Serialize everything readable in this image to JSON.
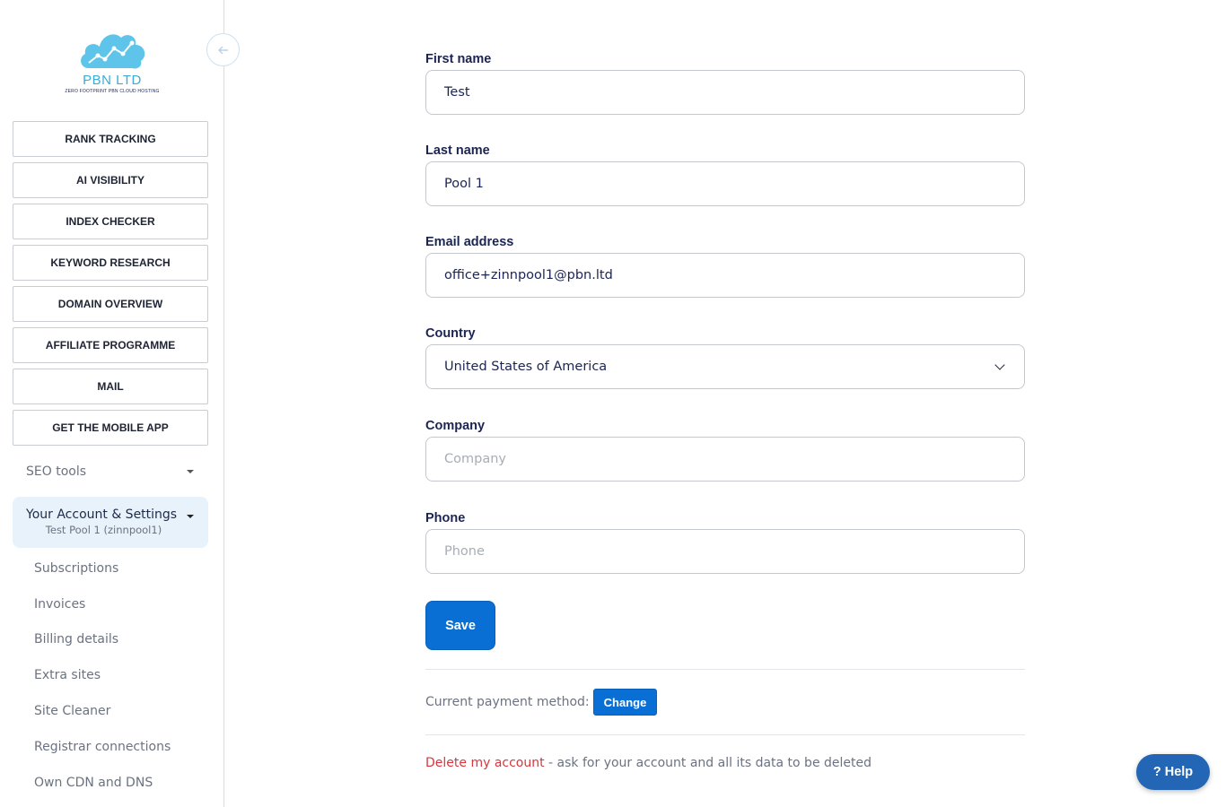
{
  "sidebar": {
    "logo_title": "PBN LTD",
    "logo_subtitle": "ZERO FOOTPRINT PBN CLOUD HOSTING",
    "nav_buttons": [
      {
        "label": "RANK TRACKING"
      },
      {
        "label": "AI VISIBILITY"
      },
      {
        "label": "INDEX CHECKER"
      },
      {
        "label": "KEYWORD RESEARCH"
      },
      {
        "label": "DOMAIN OVERVIEW"
      },
      {
        "label": "AFFILIATE PROGRAMME"
      },
      {
        "label": "MAIL"
      },
      {
        "label": "GET THE MOBILE APP"
      }
    ],
    "seo_tools_label": "SEO tools",
    "account": {
      "title": "Your Account & Settings",
      "subtitle": "Test Pool 1 (zinnpool1)"
    },
    "sub_items": [
      {
        "label": "Subscriptions"
      },
      {
        "label": "Invoices"
      },
      {
        "label": "Billing details"
      },
      {
        "label": "Extra sites"
      },
      {
        "label": "Site Cleaner"
      },
      {
        "label": "Registrar connections"
      },
      {
        "label": "Own CDN and DNS"
      }
    ]
  },
  "form": {
    "first_name": {
      "label": "First name",
      "value": "Test"
    },
    "last_name": {
      "label": "Last name",
      "value": "Pool 1"
    },
    "email": {
      "label": "Email address",
      "value": "office+zinnpool1@pbn.ltd"
    },
    "country": {
      "label": "Country",
      "value": "United States of America"
    },
    "company": {
      "label": "Company",
      "placeholder": "Company"
    },
    "phone": {
      "label": "Phone",
      "placeholder": "Phone"
    },
    "save_label": "Save"
  },
  "payment": {
    "label": "Current payment method:",
    "change_label": "Change"
  },
  "delete": {
    "link_label": "Delete my account",
    "description": " - ask for your account and all its data to be deleted"
  },
  "help_label": "? Help",
  "colors": {
    "primary": "#0a6fd4",
    "logo": "#3eaad5",
    "text": "#1b2453",
    "danger": "#d9363e",
    "account_bg": "#e8f2fb",
    "help": "#2266b5"
  }
}
